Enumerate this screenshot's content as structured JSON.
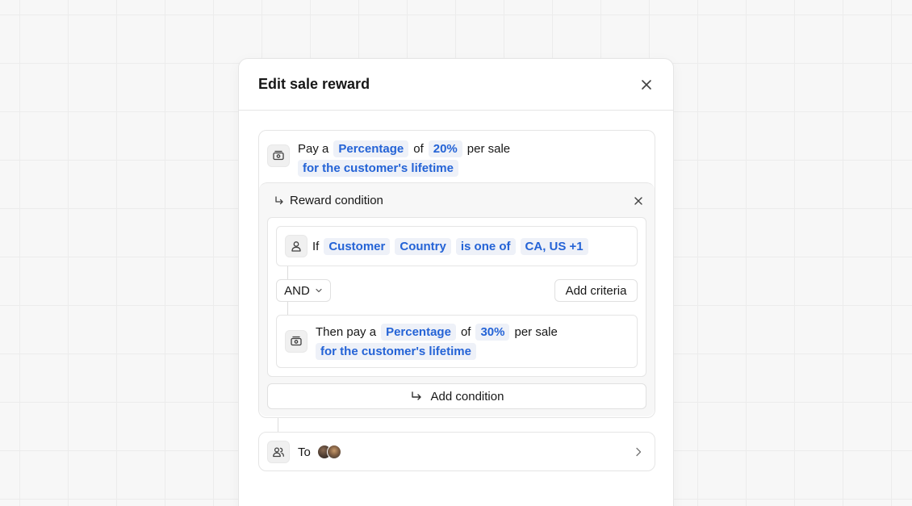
{
  "modal": {
    "title": "Edit sale reward"
  },
  "reward": {
    "prefix": "Pay a",
    "type_value": "Percentage",
    "of_text": "of",
    "amount_value": "20%",
    "suffix": "per sale",
    "duration_value": "for the customer's lifetime"
  },
  "condition": {
    "header_label": "Reward condition",
    "criteria": {
      "if_text": "If",
      "entity": "Customer",
      "attribute": "Country",
      "operator": "is one of",
      "values": "CA, US +1"
    },
    "logic_operator": "AND",
    "add_criteria_label": "Add criteria",
    "then": {
      "prefix": "Then pay a",
      "type_value": "Percentage",
      "of_text": "of",
      "amount_value": "30%",
      "suffix": "per sale",
      "duration_value": "for the customer's lifetime"
    }
  },
  "add_condition_label": "Add condition",
  "recipients": {
    "label": "To",
    "avatars": [
      "partner-avatar-1",
      "partner-avatar-2"
    ]
  },
  "colors": {
    "accent": "#2463d6",
    "pill_bg": "#eef1f8",
    "border": "#e5e5e5",
    "panel_bg": "#f7f7f7"
  },
  "icons": {
    "close": "close-icon",
    "money": "money-icon",
    "condition_arrow": "corner-down-right-icon",
    "user": "user-icon",
    "chevron_down": "chevron-down-icon",
    "users": "users-icon",
    "chevron_right": "chevron-right-icon"
  }
}
